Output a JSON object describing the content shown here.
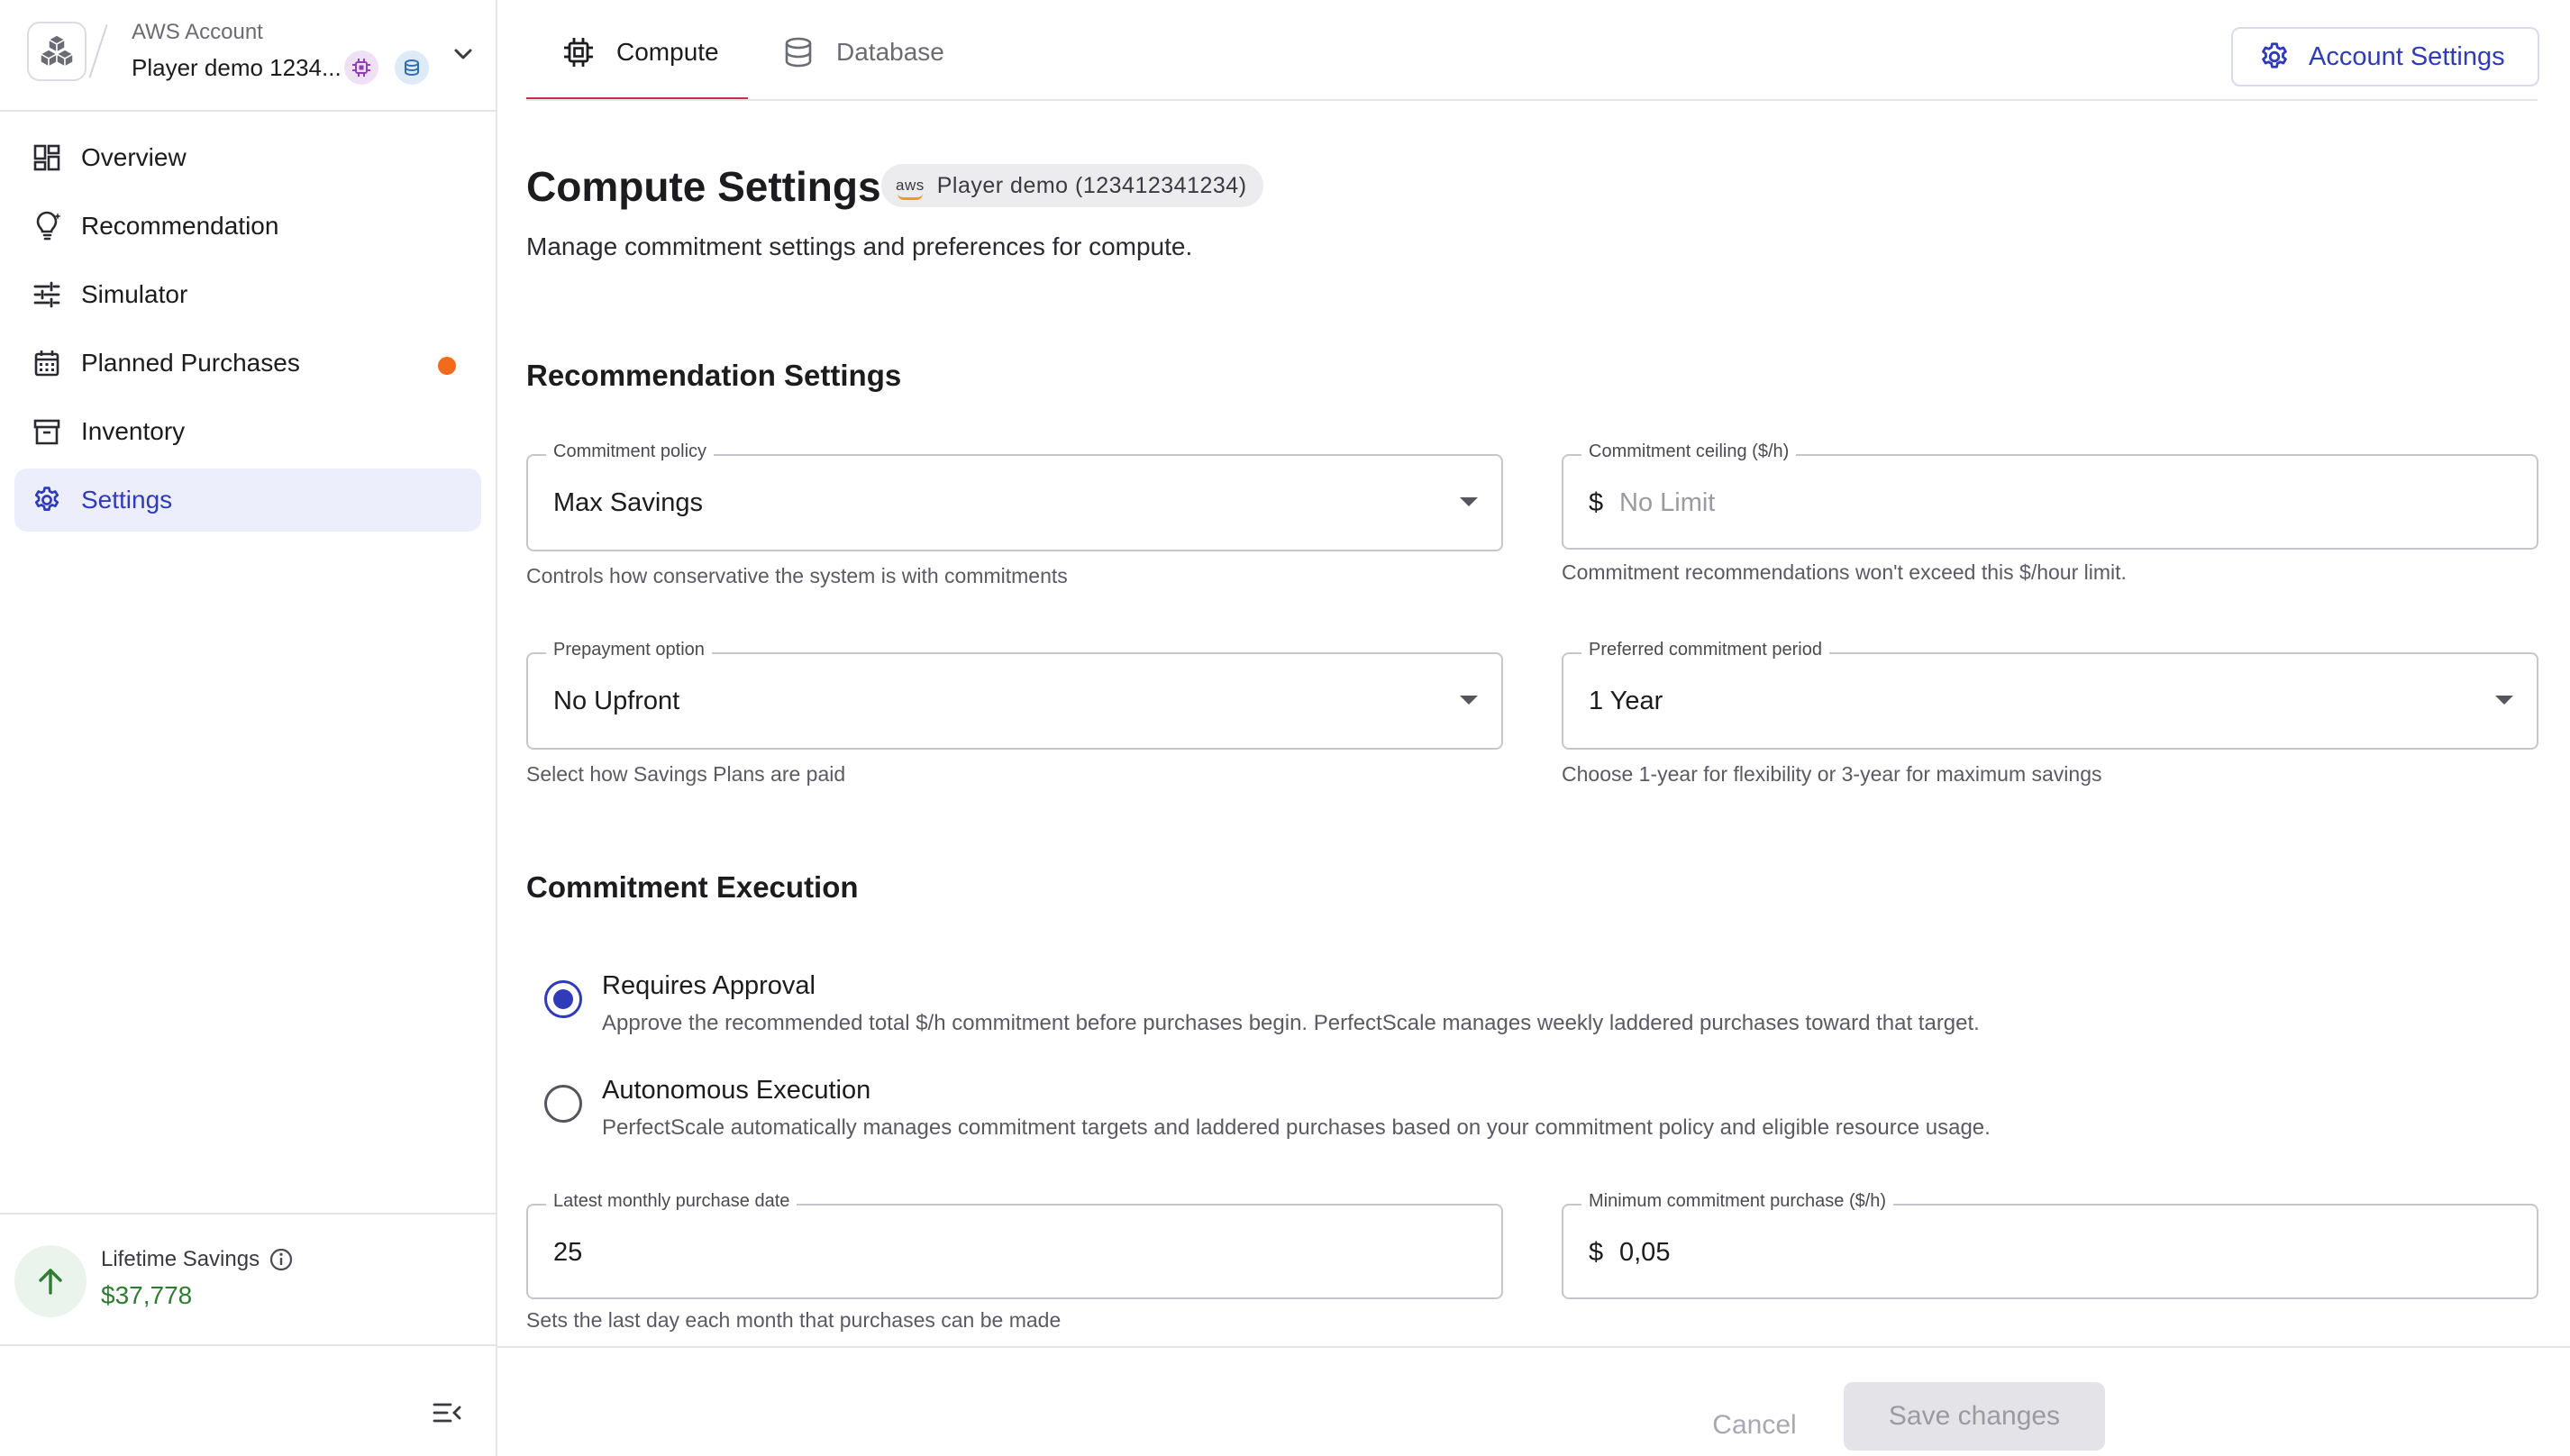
{
  "account": {
    "label": "AWS Account",
    "name": "Player demo 1234...",
    "colors": {
      "compute_badge": "#efe0f5",
      "database_badge": "#dfeaf7"
    }
  },
  "sidebar": {
    "items": [
      {
        "label": "Overview",
        "icon": "dashboard-icon"
      },
      {
        "label": "Recommendation",
        "icon": "lightbulb-icon"
      },
      {
        "label": "Simulator",
        "icon": "sliders-icon"
      },
      {
        "label": "Planned Purchases",
        "icon": "calendar-icon",
        "has_dot": true
      },
      {
        "label": "Inventory",
        "icon": "archive-icon"
      },
      {
        "label": "Settings",
        "icon": "gear-icon",
        "active": true
      }
    ],
    "lifetime_savings": {
      "label": "Lifetime Savings",
      "value": "$37,778"
    }
  },
  "tabs": [
    {
      "label": "Compute",
      "icon": "chip-icon",
      "active": true
    },
    {
      "label": "Database",
      "icon": "database-icon",
      "active": false
    }
  ],
  "header": {
    "account_settings_label": "Account Settings"
  },
  "page": {
    "title": "Compute Settings",
    "chip": {
      "aws": "aws",
      "label": "Player demo (123412341234)"
    },
    "subtitle": "Manage commitment settings and preferences for compute."
  },
  "recommendation": {
    "title": "Recommendation Settings",
    "commitment_policy": {
      "label": "Commitment policy",
      "value": "Max Savings",
      "helper": "Controls how conservative the system is with commitments"
    },
    "commitment_ceiling": {
      "label": "Commitment ceiling ($/h)",
      "prefix": "$",
      "placeholder": "No Limit",
      "helper": "Commitment recommendations won't exceed this $/hour limit."
    },
    "prepayment": {
      "label": "Prepayment option",
      "value": "No Upfront",
      "helper": "Select how Savings Plans are paid"
    },
    "period": {
      "label": "Preferred commitment period",
      "value": "1 Year",
      "helper": "Choose 1-year for flexibility or 3-year for maximum savings"
    }
  },
  "execution": {
    "title": "Commitment Execution",
    "options": [
      {
        "title": "Requires Approval",
        "desc": "Approve the recommended total $/h commitment before purchases begin. PerfectScale manages weekly laddered purchases toward that target.",
        "checked": true
      },
      {
        "title": "Autonomous Execution",
        "desc": "PerfectScale automatically manages commitment targets and laddered purchases based on your commitment policy and eligible resource usage.",
        "checked": false
      }
    ],
    "purchase_date": {
      "label": "Latest monthly purchase date",
      "value": "25",
      "helper": "Sets the last day each month that purchases can be made"
    },
    "min_purchase": {
      "label": "Minimum commitment purchase ($/h)",
      "prefix": "$",
      "value": "0,05"
    }
  },
  "footer": {
    "cancel": "Cancel",
    "save": "Save changes"
  },
  "colors": {
    "accent": "#2f3bb8",
    "tab_underline": "#d42a4a",
    "savings_green": "#2e7d32",
    "notification": "#f26a1b"
  }
}
